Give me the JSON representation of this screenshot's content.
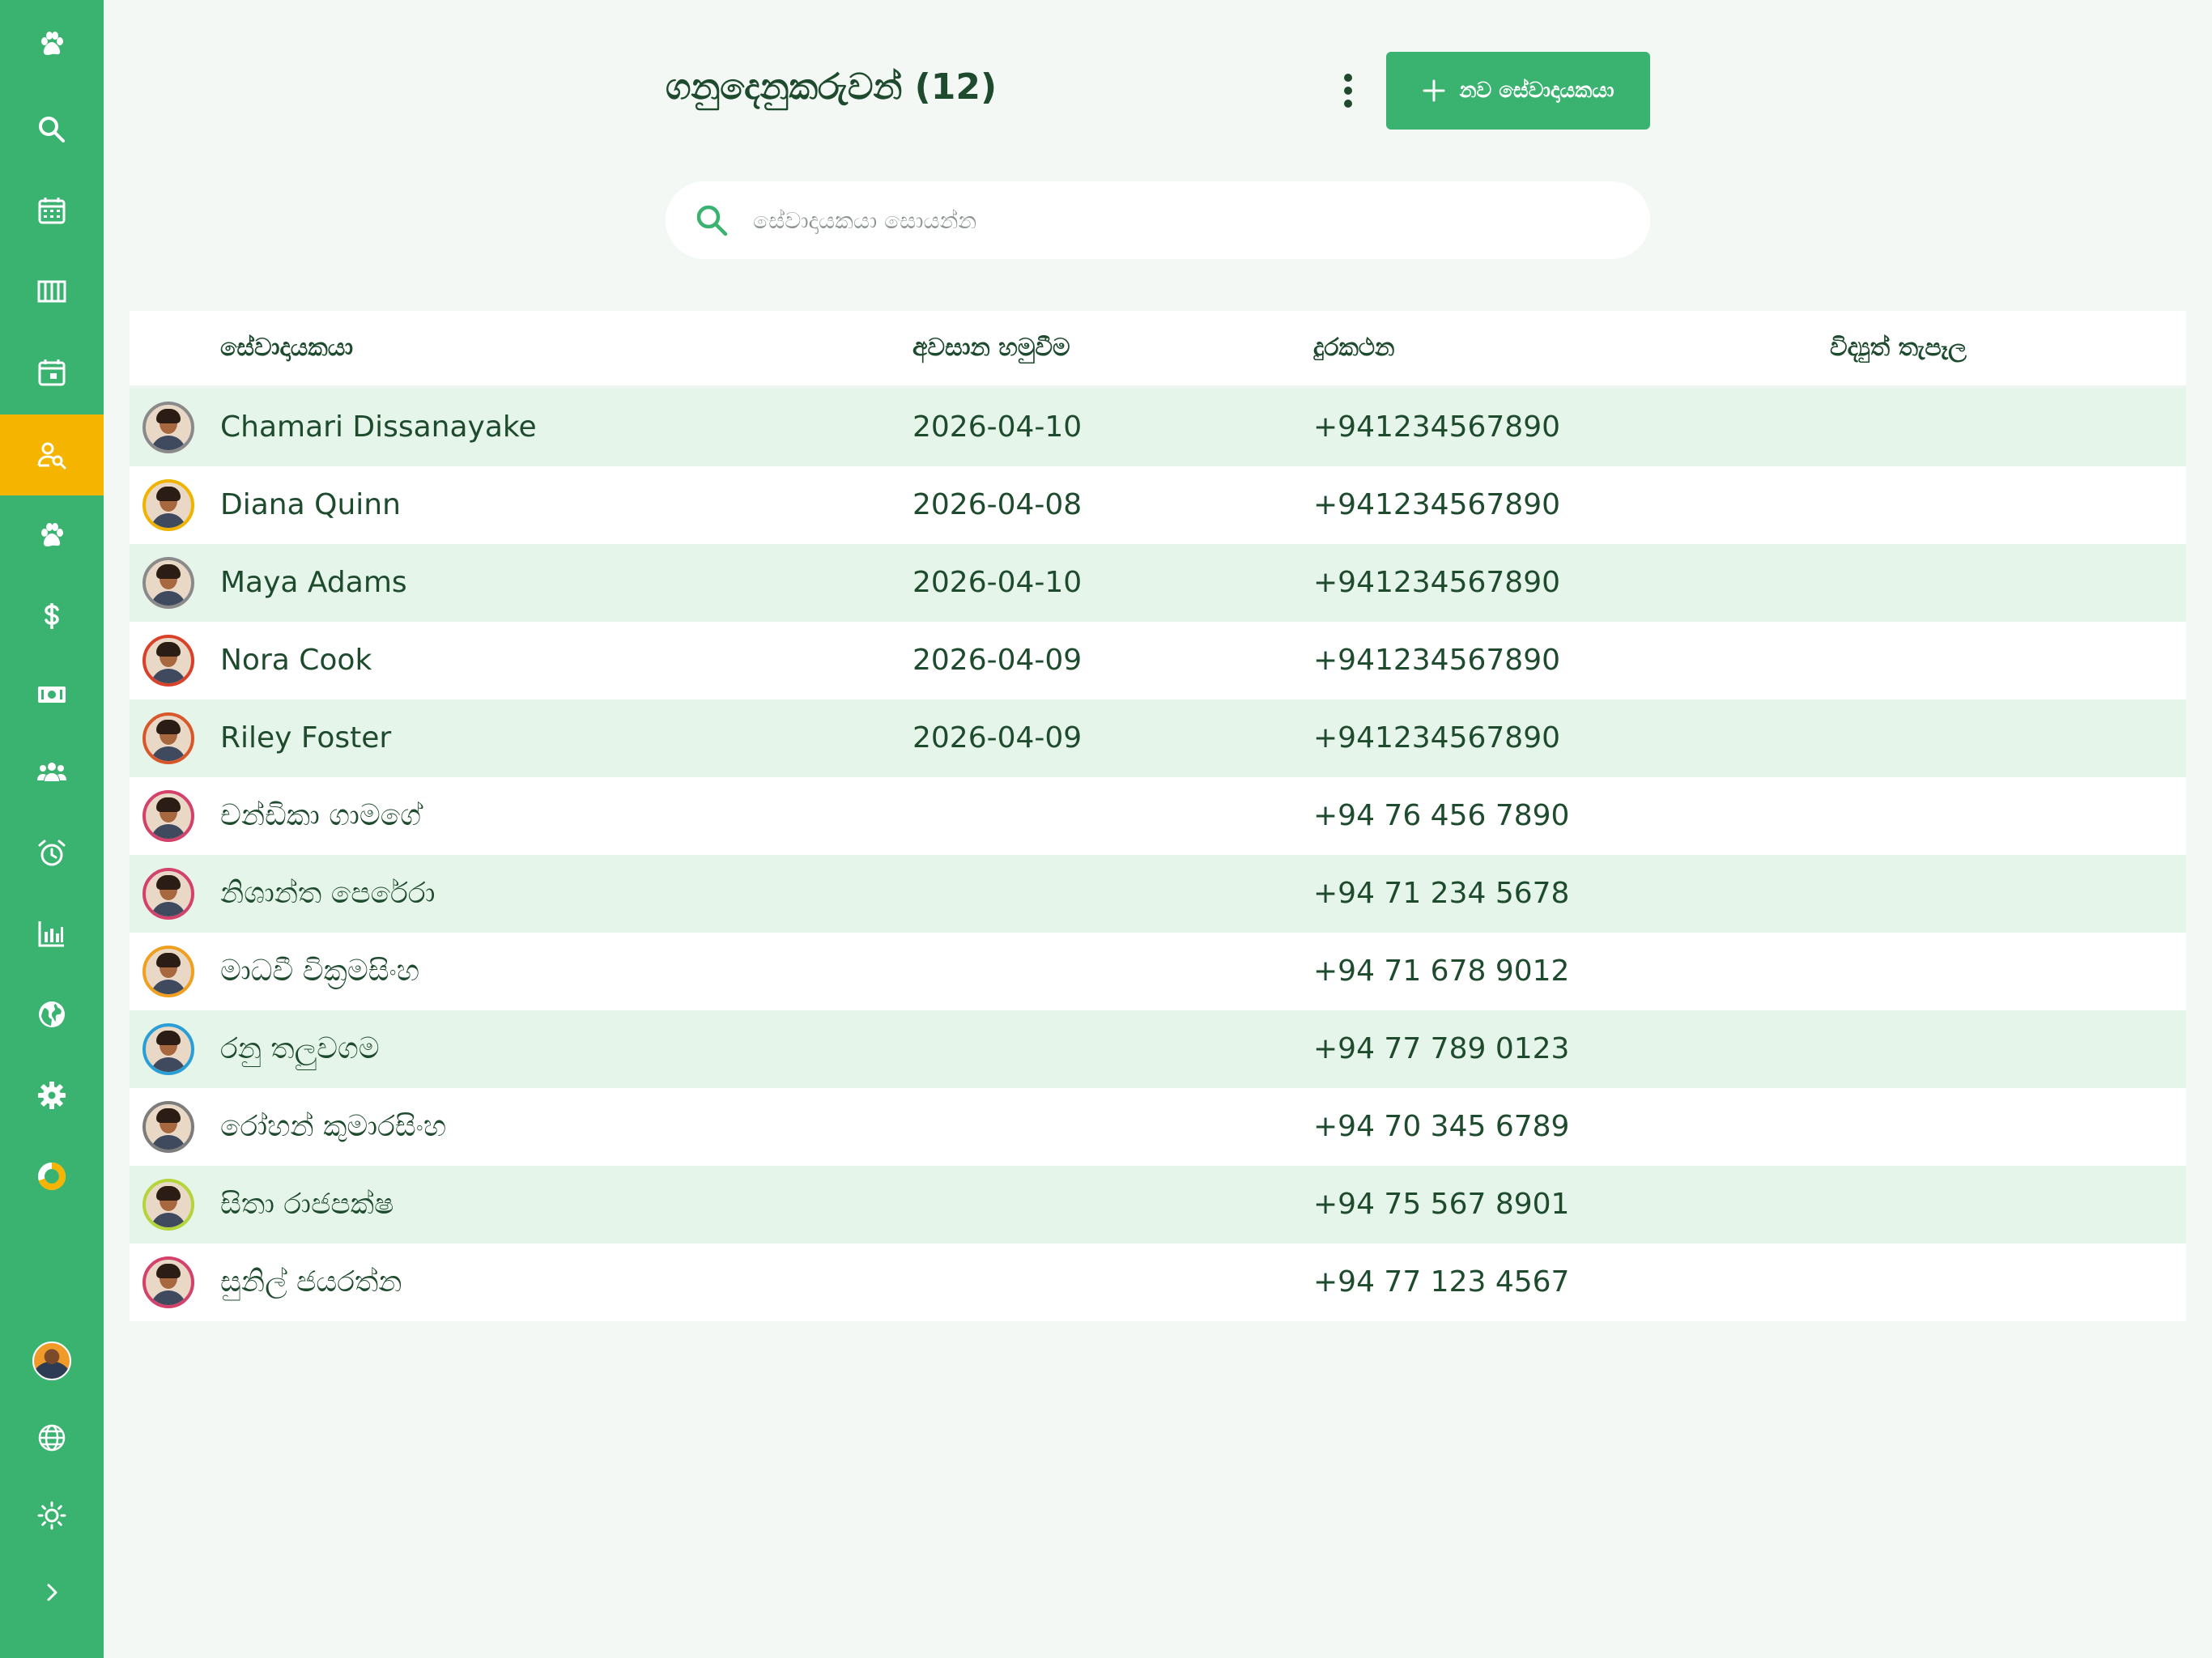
{
  "sidebar": {
    "items": [
      {
        "icon": "paw-icon",
        "active": false
      },
      {
        "icon": "search-icon",
        "active": false
      },
      {
        "icon": "calendar-grid-icon",
        "active": false
      },
      {
        "icon": "columns-icon",
        "active": false
      },
      {
        "icon": "calendar-day-icon",
        "active": false
      },
      {
        "icon": "user-search-icon",
        "active": true
      },
      {
        "icon": "paw-icon",
        "active": false
      },
      {
        "icon": "dollar-icon",
        "active": false
      },
      {
        "icon": "cash-icon",
        "active": false
      },
      {
        "icon": "group-icon",
        "active": false
      },
      {
        "icon": "alarm-clock-icon",
        "active": false
      },
      {
        "icon": "bar-chart-icon",
        "active": false
      },
      {
        "icon": "globe-filled-icon",
        "active": false
      },
      {
        "icon": "gear-icon",
        "active": false
      },
      {
        "icon": "donut-chart-icon",
        "active": false
      }
    ],
    "bottom": [
      {
        "icon": "user-avatar"
      },
      {
        "icon": "globe-outline-icon"
      },
      {
        "icon": "sun-icon"
      },
      {
        "icon": "chevron-right-icon"
      }
    ],
    "active_color": "#f5b400",
    "bg_color": "#3bb370"
  },
  "header": {
    "title": "ගනුදෙනුකරුවන් (12)",
    "more_icon": "more-vertical-icon",
    "new_button_label": "නව සේවාදායකයා"
  },
  "search": {
    "placeholder": "සේවාදායකයා සොයන්න",
    "value": ""
  },
  "table": {
    "columns": [
      "සේවාදායකයා",
      "අවසාන හමුවීම",
      "දුරකථන",
      "විද්‍යුත් තැපෑල"
    ],
    "rows": [
      {
        "name": "Chamari Dissanayake",
        "last_visit": "2026-04-10",
        "phone": "+941234567890",
        "email": "",
        "avatar_ring": "#8a8a8a"
      },
      {
        "name": "Diana Quinn",
        "last_visit": "2026-04-08",
        "phone": "+941234567890",
        "email": "",
        "avatar_ring": "#f0b400"
      },
      {
        "name": "Maya Adams",
        "last_visit": "2026-04-10",
        "phone": "+941234567890",
        "email": "",
        "avatar_ring": "#8a8a8a"
      },
      {
        "name": "Nora Cook",
        "last_visit": "2026-04-09",
        "phone": "+941234567890",
        "email": "",
        "avatar_ring": "#d9412b"
      },
      {
        "name": "Riley Foster",
        "last_visit": "2026-04-09",
        "phone": "+941234567890",
        "email": "",
        "avatar_ring": "#d9582b"
      },
      {
        "name": "චන්ඩිකා ගාමගේ",
        "last_visit": "",
        "phone": "+94 76 456 7890",
        "email": "",
        "avatar_ring": "#d4416a"
      },
      {
        "name": "නිශාන්ත පෙරේරා",
        "last_visit": "",
        "phone": "+94 71 234 5678",
        "email": "",
        "avatar_ring": "#d4416a"
      },
      {
        "name": "මාධවී වික්‍රමසිංහ",
        "last_visit": "",
        "phone": "+94 71 678 9012",
        "email": "",
        "avatar_ring": "#f0a020"
      },
      {
        "name": "රනු තලුවගම",
        "last_visit": "",
        "phone": "+94 77 789 0123",
        "email": "",
        "avatar_ring": "#2a9fd6"
      },
      {
        "name": "රෝහන් කුමාරසිංහ",
        "last_visit": "",
        "phone": "+94 70 345 6789",
        "email": "",
        "avatar_ring": "#7d7d7d"
      },
      {
        "name": "සිතා රාජපක්ෂ",
        "last_visit": "",
        "phone": "+94 75 567 8901",
        "email": "",
        "avatar_ring": "#b5d43a"
      },
      {
        "name": "සුනිල් ජයරත්න",
        "last_visit": "",
        "phone": "+94 77 123 4567",
        "email": "",
        "avatar_ring": "#d4416a"
      }
    ]
  }
}
